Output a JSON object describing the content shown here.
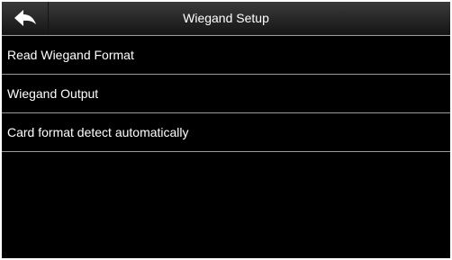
{
  "header": {
    "title": "Wiegand Setup",
    "back_icon": "back-arrow-icon"
  },
  "menu": {
    "items": [
      {
        "label": "Read Wiegand Format"
      },
      {
        "label": "Wiegand Output"
      },
      {
        "label": "Card format detect automatically"
      }
    ]
  },
  "colors": {
    "background": "#000000",
    "header_top": "#3a3a3a",
    "header_bottom": "#151515",
    "text": "#ffffff",
    "separator": "#9a9a9a"
  }
}
